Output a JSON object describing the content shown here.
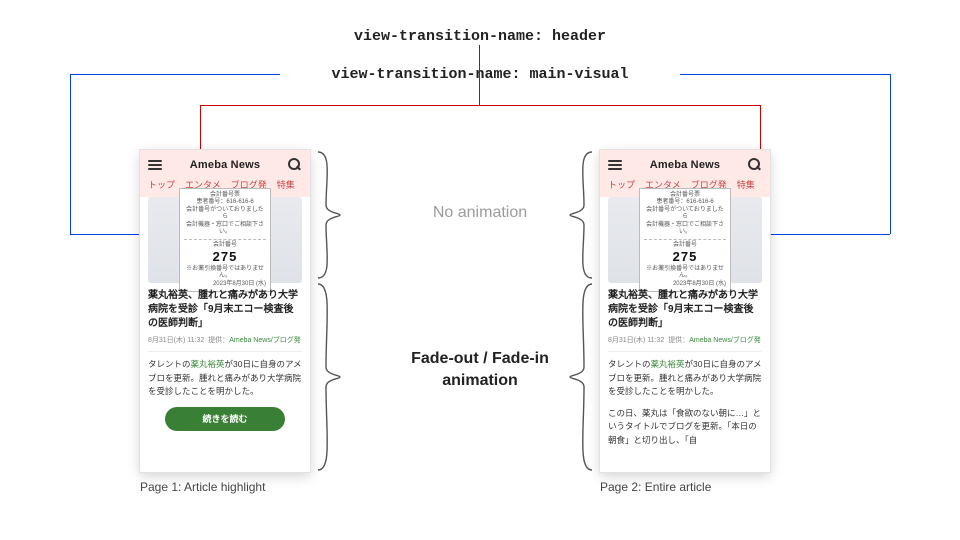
{
  "callouts": {
    "header": "view-transition-name: header",
    "main_visual": "view-transition-name: main-visual"
  },
  "center_labels": {
    "no_animation": "No animation",
    "fade": "Fade-out / Fade-in\nanimation"
  },
  "captions": {
    "page1": "Page 1: Article highlight",
    "page2": "Page 2: Entire article"
  },
  "phone": {
    "brand": "Ameba News",
    "tabs": [
      "トップ",
      "エンタメ",
      "ブログ発",
      "特集"
    ],
    "ticket": {
      "line1": "会計番号票",
      "line2": "患者番号：616-616-6",
      "line3": "会計番号がついておりましたら\n会計機器・窓口でご相談下さい。",
      "label": "会計番号",
      "number": "275",
      "footer": "※お薬引換番号ではありません。",
      "date": "2023年8月30日 (水)"
    },
    "article": {
      "title": "薬丸裕英、腫れと痛みがあり大学病院を受診「9月末エコー検査後の医師判断」",
      "meta_time": "8月31日(木) 11:32",
      "meta_provider_label": "提供：",
      "meta_source": "Ameba News/ブログ発",
      "excerpt_prefix": "タレントの",
      "excerpt_highlight": "薬丸裕英",
      "excerpt_rest": "が30日に自身のアメブロを更新。腫れと痛みがあり大学病院を受診したことを明かした。",
      "cta": "続きを読む",
      "full_extra": "この日、薬丸は「食欲のない朝に…」というタイトルでブログを更新。「本日の朝食」と切り出し、「自"
    }
  }
}
